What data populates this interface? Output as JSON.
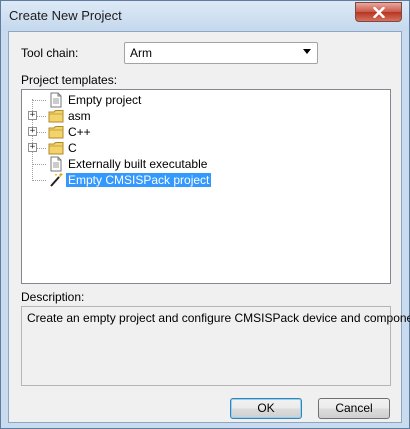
{
  "window": {
    "title": "Create New Project"
  },
  "toolchain": {
    "label": "Tool chain:",
    "value": "Arm"
  },
  "templates": {
    "label": "Project templates:",
    "items": [
      {
        "label": "Empty project",
        "icon": "document-icon",
        "expandable": false,
        "selected": false
      },
      {
        "label": "asm",
        "icon": "folder-icon",
        "expandable": true,
        "selected": false
      },
      {
        "label": "C++",
        "icon": "folder-icon",
        "expandable": true,
        "selected": false
      },
      {
        "label": "C",
        "icon": "folder-icon",
        "expandable": true,
        "selected": false
      },
      {
        "label": "Externally built executable",
        "icon": "document-icon",
        "expandable": false,
        "selected": false
      },
      {
        "label": "Empty CMSISPack project",
        "icon": "magic-wand-icon",
        "expandable": false,
        "selected": true
      }
    ]
  },
  "description": {
    "label": "Description:",
    "text": "Create an empty project and configure CMSISPack device and components"
  },
  "buttons": {
    "ok": "OK",
    "cancel": "Cancel"
  },
  "colors": {
    "selection": "#3399ff",
    "folder": "#f3d36b",
    "close": "#c9584a"
  }
}
